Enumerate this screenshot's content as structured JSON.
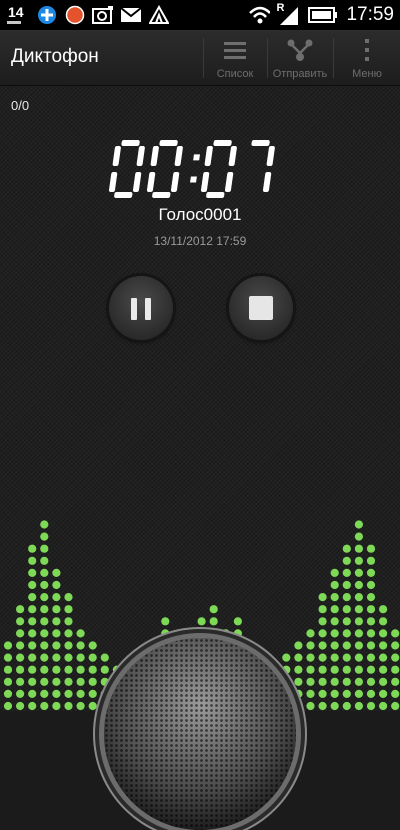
{
  "status_bar": {
    "notification_count": "14",
    "time": "17:59",
    "roaming_indicator": "R",
    "icons": [
      "notification-count-icon",
      "plus-icon",
      "red-dot-icon",
      "camera-icon",
      "gmail-icon",
      "triangle-icon",
      "wifi-icon",
      "signal-icon",
      "battery-icon"
    ]
  },
  "titlebar": {
    "title": "Диктофон",
    "actions": [
      {
        "label": "Список",
        "icon": "list-icon"
      },
      {
        "label": "Отправить",
        "icon": "share-icon"
      },
      {
        "label": "Меню",
        "icon": "menu-dots-icon"
      }
    ]
  },
  "recorder": {
    "counter": "0/0",
    "timer": "00:07",
    "name": "Голос0001",
    "date": "13/11/2012 17:59"
  },
  "controls": {
    "pause_icon": "pause-icon",
    "stop_icon": "stop-icon"
  },
  "visualizer": {
    "color": "#7ed957",
    "levels": [
      0.4,
      0.55,
      0.88,
      1.0,
      0.75,
      0.6,
      0.45,
      0.38,
      0.3,
      0.25,
      0.16,
      0.25,
      0.35,
      0.5,
      0.25,
      0.42,
      0.5,
      0.55,
      0.42,
      0.48,
      0.28,
      0.22,
      0.25,
      0.3,
      0.4,
      0.45,
      0.6,
      0.75,
      0.88,
      1.0,
      0.88,
      0.55,
      0.45
    ]
  },
  "colors": {
    "background": "#202020",
    "accent_green": "#7ed957",
    "label_gray": "#6e6e6e"
  }
}
